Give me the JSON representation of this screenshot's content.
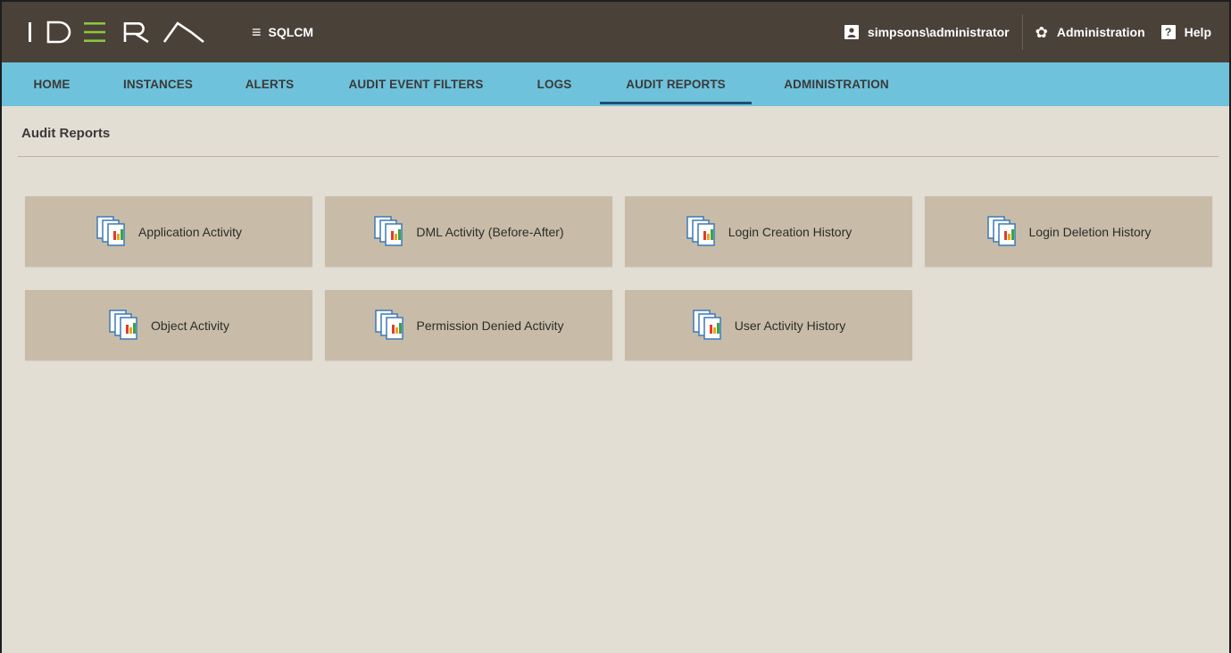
{
  "brand": {
    "logo_text": "IDERA",
    "product": "SQLCM"
  },
  "top_right": {
    "user": "simpsons\\administrator",
    "administration": "Administration",
    "help": "Help"
  },
  "nav": {
    "tabs": [
      {
        "label": "HOME"
      },
      {
        "label": "INSTANCES"
      },
      {
        "label": "ALERTS"
      },
      {
        "label": "AUDIT EVENT FILTERS"
      },
      {
        "label": "LOGS"
      },
      {
        "label": "AUDIT REPORTS",
        "active": true
      },
      {
        "label": "ADMINISTRATION"
      }
    ]
  },
  "page": {
    "title": "Audit Reports"
  },
  "reports": [
    {
      "label": "Application Activity"
    },
    {
      "label": "DML Activity (Before-After)"
    },
    {
      "label": "Login Creation History"
    },
    {
      "label": "Login Deletion History"
    },
    {
      "label": "Object Activity"
    },
    {
      "label": "Permission Denied Activity"
    },
    {
      "label": "User Activity History"
    }
  ],
  "icons": {
    "menu": "hamburger-icon",
    "user": "user-icon",
    "administration": "gear-icon",
    "help": "help-icon",
    "report": "report-stack-icon"
  },
  "colors": {
    "topbar": "#4a4139",
    "navbar": "#6fc2db",
    "active_underline": "#1f4f70",
    "tile": "#c8bca8",
    "background": "#e3ded4",
    "logo_accent": "#8cc63f"
  }
}
